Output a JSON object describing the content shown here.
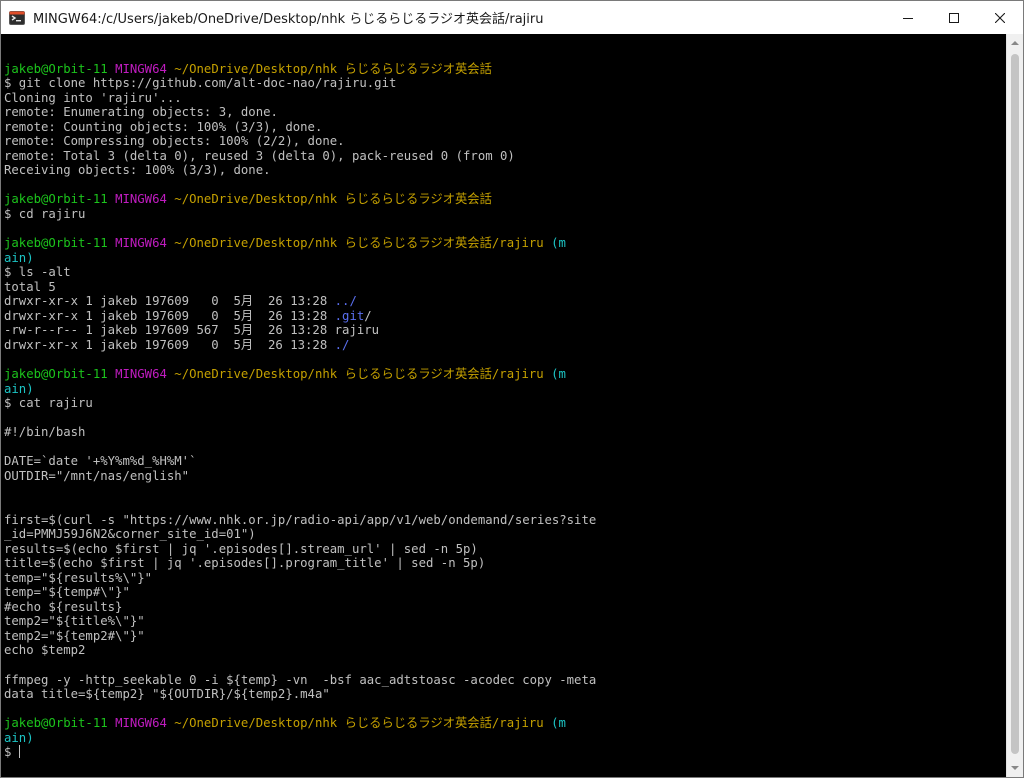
{
  "window": {
    "title": "MINGW64:/c/Users/jakeb/OneDrive/Desktop/nhk らじるらじるラジオ英会話/rajiru",
    "icon": "git-bash-icon",
    "controls": [
      "minimize-icon",
      "maximize-icon",
      "close-icon"
    ]
  },
  "colors": {
    "default": "#c0c0c0",
    "green": "#1cc41c",
    "magenta": "#c01cc0",
    "yellow": "#c4a000",
    "cyan": "#1cc4c4",
    "blue": "#5a6ff0"
  },
  "terminal": {
    "lines": [
      [],
      [
        {
          "t": "jakeb@Orbit-11 ",
          "c": "green"
        },
        {
          "t": "MINGW64 ",
          "c": "magenta"
        },
        {
          "t": "~/OneDrive/Desktop/nhk らじるらじるラジオ英会話",
          "c": "yellow"
        }
      ],
      [
        {
          "t": "$ git clone https://github.com/alt-doc-nao/rajiru.git"
        }
      ],
      [
        {
          "t": "Cloning into 'rajiru'..."
        }
      ],
      [
        {
          "t": "remote: Enumerating objects: 3, done."
        }
      ],
      [
        {
          "t": "remote: Counting objects: 100% (3/3), done."
        }
      ],
      [
        {
          "t": "remote: Compressing objects: 100% (2/2), done."
        }
      ],
      [
        {
          "t": "remote: Total 3 (delta 0), reused 3 (delta 0), pack-reused 0 (from 0)"
        }
      ],
      [
        {
          "t": "Receiving objects: 100% (3/3), done."
        }
      ],
      [],
      [
        {
          "t": "jakeb@Orbit-11 ",
          "c": "green"
        },
        {
          "t": "MINGW64 ",
          "c": "magenta"
        },
        {
          "t": "~/OneDrive/Desktop/nhk らじるらじるラジオ英会話",
          "c": "yellow"
        }
      ],
      [
        {
          "t": "$ cd rajiru"
        }
      ],
      [],
      [
        {
          "t": "jakeb@Orbit-11 ",
          "c": "green"
        },
        {
          "t": "MINGW64 ",
          "c": "magenta"
        },
        {
          "t": "~/OneDrive/Desktop/nhk らじるらじるラジオ英会話/rajiru",
          "c": "yellow"
        },
        {
          "t": " (m",
          "c": "cyan"
        }
      ],
      [
        {
          "t": "ain)",
          "c": "cyan"
        }
      ],
      [
        {
          "t": "$ ls -alt"
        }
      ],
      [
        {
          "t": "total 5"
        }
      ],
      [
        {
          "t": "drwxr-xr-x 1 jakeb 197609   0  5月  26 13:28 "
        },
        {
          "t": "../",
          "c": "blue"
        }
      ],
      [
        {
          "t": "drwxr-xr-x 1 jakeb 197609   0  5月  26 13:28 "
        },
        {
          "t": ".git",
          "c": "blue"
        },
        {
          "t": "/"
        }
      ],
      [
        {
          "t": "-rw-r--r-- 1 jakeb 197609 567  5月  26 13:28 rajiru"
        }
      ],
      [
        {
          "t": "drwxr-xr-x 1 jakeb 197609   0  5月  26 13:28 "
        },
        {
          "t": "./",
          "c": "blue"
        }
      ],
      [],
      [
        {
          "t": "jakeb@Orbit-11 ",
          "c": "green"
        },
        {
          "t": "MINGW64 ",
          "c": "magenta"
        },
        {
          "t": "~/OneDrive/Desktop/nhk らじるらじるラジオ英会話/rajiru",
          "c": "yellow"
        },
        {
          "t": " (m",
          "c": "cyan"
        }
      ],
      [
        {
          "t": "ain)",
          "c": "cyan"
        }
      ],
      [
        {
          "t": "$ cat rajiru"
        }
      ],
      [],
      [
        {
          "t": "#!/bin/bash"
        }
      ],
      [],
      [
        {
          "t": "DATE=`date '+%Y%m%d_%H%M'`"
        }
      ],
      [
        {
          "t": "OUTDIR=\"/mnt/nas/english\""
        }
      ],
      [],
      [],
      [
        {
          "t": "first=$(curl -s \"https://www.nhk.or.jp/radio-api/app/v1/web/ondemand/series?site"
        }
      ],
      [
        {
          "t": "_id=PMMJ59J6N2&corner_site_id=01\")"
        }
      ],
      [
        {
          "t": "results=$(echo $first | jq '.episodes[].stream_url' | sed -n 5p)"
        }
      ],
      [
        {
          "t": "title=$(echo $first | jq '.episodes[].program_title' | sed -n 5p)"
        }
      ],
      [
        {
          "t": "temp=\"${results%\\\"}\""
        }
      ],
      [
        {
          "t": "temp=\"${temp#\\\"}\""
        }
      ],
      [
        {
          "t": "#echo ${results}"
        }
      ],
      [
        {
          "t": "temp2=\"${title%\\\"}\""
        }
      ],
      [
        {
          "t": "temp2=\"${temp2#\\\"}\""
        }
      ],
      [
        {
          "t": "echo $temp2"
        }
      ],
      [],
      [
        {
          "t": "ffmpeg -y -http_seekable 0 -i ${temp} -vn  -bsf aac_adtstoasc -acodec copy -meta"
        }
      ],
      [
        {
          "t": "data title=${temp2} \"${OUTDIR}/${temp2}.m4a\""
        }
      ],
      [],
      [
        {
          "t": "jakeb@Orbit-11 ",
          "c": "green"
        },
        {
          "t": "MINGW64 ",
          "c": "magenta"
        },
        {
          "t": "~/OneDrive/Desktop/nhk らじるらじるラジオ英会話/rajiru",
          "c": "yellow"
        },
        {
          "t": " (m",
          "c": "cyan"
        }
      ],
      [
        {
          "t": "ain)",
          "c": "cyan"
        }
      ],
      [
        {
          "t": "$ ",
          "cursor": true
        }
      ]
    ]
  }
}
